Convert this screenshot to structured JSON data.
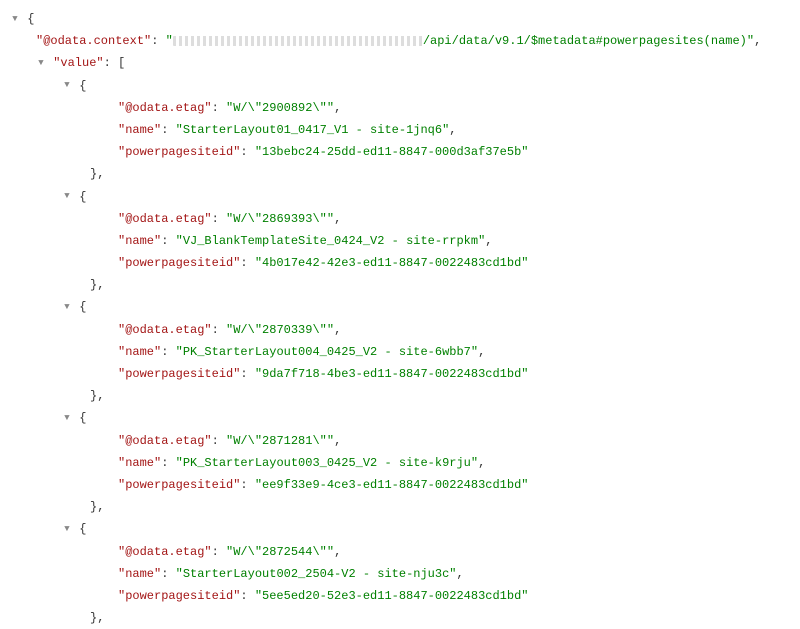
{
  "root": {
    "context_key": "\"@odata.context\"",
    "context_value_suffix": "/api/data/v9.1/$metadata#powerpagesites(name)\"",
    "value_key": "\"value\"",
    "open_brace": "{",
    "close_brace": "}",
    "open_bracket": "[",
    "colon_space": ": ",
    "comma": ",",
    "quote": "\""
  },
  "items": [
    {
      "etag_key": "\"@odata.etag\"",
      "etag_val": "\"W/\\\"2900892\\\"\"",
      "name_key": "\"name\"",
      "name_val": "\"StarterLayout01_0417_V1 - site-1jnq6\"",
      "id_key": "\"powerpagesiteid\"",
      "id_val": "\"13bebc24-25dd-ed11-8847-000d3af37e5b\""
    },
    {
      "etag_key": "\"@odata.etag\"",
      "etag_val": "\"W/\\\"2869393\\\"\"",
      "name_key": "\"name\"",
      "name_val": "\"VJ_BlankTemplateSite_0424_V2 - site-rrpkm\"",
      "id_key": "\"powerpagesiteid\"",
      "id_val": "\"4b017e42-42e3-ed11-8847-0022483cd1bd\""
    },
    {
      "etag_key": "\"@odata.etag\"",
      "etag_val": "\"W/\\\"2870339\\\"\"",
      "name_key": "\"name\"",
      "name_val": "\"PK_StarterLayout004_0425_V2 - site-6wbb7\"",
      "id_key": "\"powerpagesiteid\"",
      "id_val": "\"9da7f718-4be3-ed11-8847-0022483cd1bd\""
    },
    {
      "etag_key": "\"@odata.etag\"",
      "etag_val": "\"W/\\\"2871281\\\"\"",
      "name_key": "\"name\"",
      "name_val": "\"PK_StarterLayout003_0425_V2 - site-k9rju\"",
      "id_key": "\"powerpagesiteid\"",
      "id_val": "\"ee9f33e9-4ce3-ed11-8847-0022483cd1bd\""
    },
    {
      "etag_key": "\"@odata.etag\"",
      "etag_val": "\"W/\\\"2872544\\\"\"",
      "name_key": "\"name\"",
      "name_val": "\"StarterLayout002_2504-V2 - site-nju3c\"",
      "id_key": "\"powerpagesiteid\"",
      "id_val": "\"5ee5ed20-52e3-ed11-8847-0022483cd1bd\""
    }
  ]
}
